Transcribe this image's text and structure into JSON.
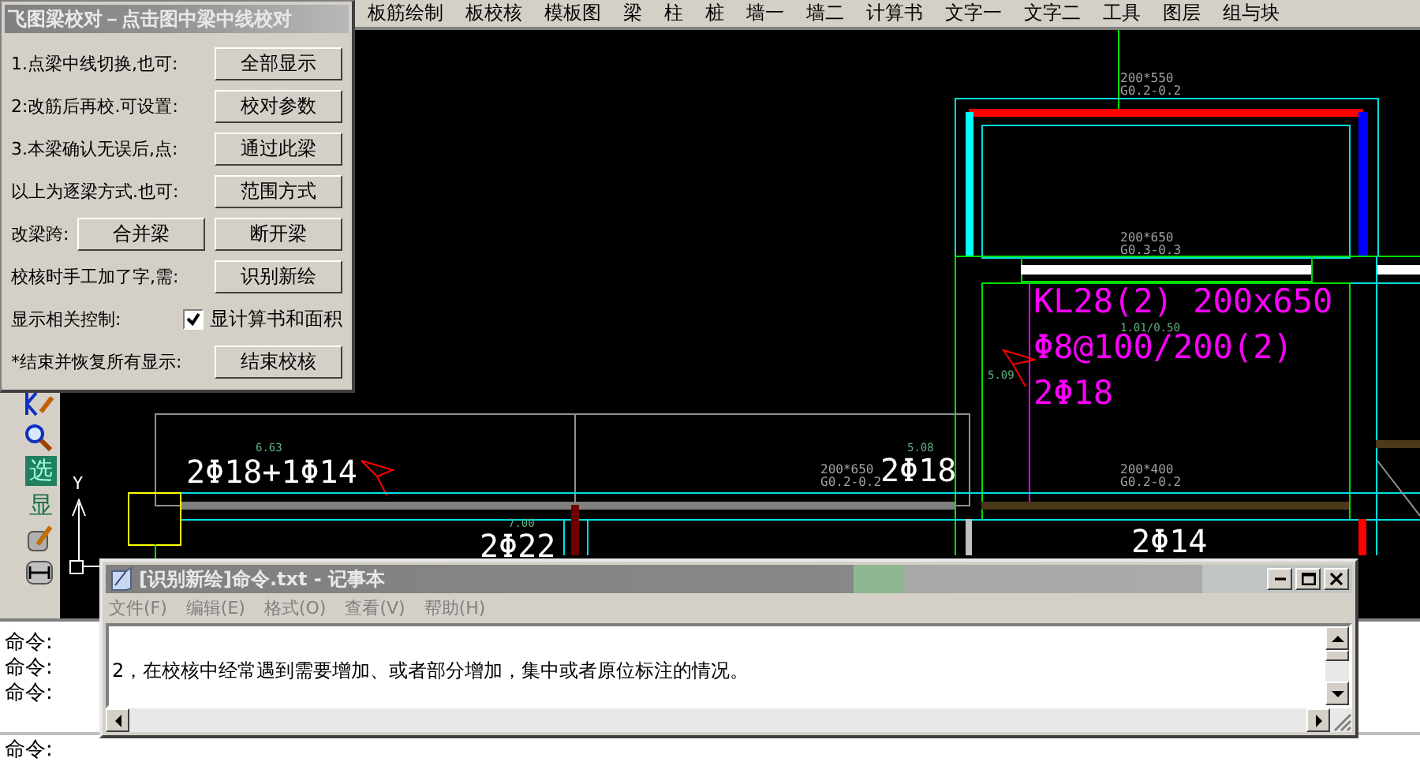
{
  "menu_bar": {
    "items": [
      "板筋绘制",
      "板校核",
      "模板图",
      "梁",
      "柱",
      "桩",
      "墙一",
      "墙二",
      "计算书",
      "文字一",
      "文字二",
      "工具",
      "图层",
      "组与块"
    ]
  },
  "dialog": {
    "title": "飞图梁校对－点击图中梁中线校对",
    "rows": [
      {
        "kind": "button",
        "label": "1.点梁中线切换,也可:",
        "buttons": [
          "全部显示"
        ]
      },
      {
        "kind": "button",
        "label": "2:改筋后再校.可设置:",
        "buttons": [
          "校对参数"
        ]
      },
      {
        "kind": "button",
        "label": "3.本梁确认无误后,点:",
        "buttons": [
          "通过此梁"
        ]
      },
      {
        "kind": "button",
        "label": "以上为逐梁方式.也可:",
        "buttons": [
          "范围方式"
        ]
      },
      {
        "kind": "button",
        "label": "改梁跨:",
        "buttons": [
          "合并梁",
          "断开梁"
        ]
      },
      {
        "kind": "button",
        "label": "校核时手工加了字,需:",
        "buttons": [
          "识别新绘"
        ]
      },
      {
        "kind": "checkbox",
        "label": "显示相关控制:",
        "option": "显计算书和面积",
        "checked": true
      },
      {
        "kind": "button",
        "label": "*结束并恢复所有显示:",
        "buttons": [
          "结束校核"
        ]
      }
    ]
  },
  "toolbar": {
    "labels": [
      "选",
      "显"
    ]
  },
  "drawing": {
    "labels": [
      {
        "kind": "size",
        "text": "200*550"
      },
      {
        "kind": "size",
        "text": "G0.2-0.2"
      },
      {
        "kind": "size",
        "text": "200*650"
      },
      {
        "kind": "size",
        "text": "G0.3-0.3"
      },
      {
        "kind": "beam",
        "text": "KL28(2) 200x650"
      },
      {
        "kind": "ratio",
        "text": "1.01/0.50"
      },
      {
        "kind": "beam",
        "text": "Φ8@100/200(2)"
      },
      {
        "kind": "ratio",
        "text": "5.09"
      },
      {
        "kind": "beam",
        "text": "2Φ18"
      },
      {
        "kind": "ratio",
        "text": "6.63"
      },
      {
        "kind": "ratio",
        "text": "5.08"
      },
      {
        "kind": "rebar",
        "text": "2Φ18+1Φ14"
      },
      {
        "kind": "size",
        "text": "200*650"
      },
      {
        "kind": "rebar",
        "text": "2Φ18"
      },
      {
        "kind": "size",
        "text": "200*400"
      },
      {
        "kind": "axis",
        "text": "Y"
      },
      {
        "kind": "size",
        "text": "G0.2-0.2"
      },
      {
        "kind": "size",
        "text": "G0.2-0.2"
      },
      {
        "kind": "ratio",
        "text": "7.00"
      },
      {
        "kind": "rebar",
        "text": "2Φ22"
      },
      {
        "kind": "rebar",
        "text": "2Φ14"
      }
    ]
  },
  "command_lines": [
    "命令:",
    "命令:",
    "命令:"
  ],
  "command_input": {
    "label": "命令:"
  },
  "notepad": {
    "title": "[识别新绘]命令.txt - 记事本",
    "menus": [
      "文件(F)",
      "编辑(E)",
      "格式(O)",
      "查看(V)",
      "帮助(H)"
    ],
    "lines": [
      "2，在校核中经常遇到需要增加、或者部分增加，集中或者原位标注的情况。"
    ]
  }
}
